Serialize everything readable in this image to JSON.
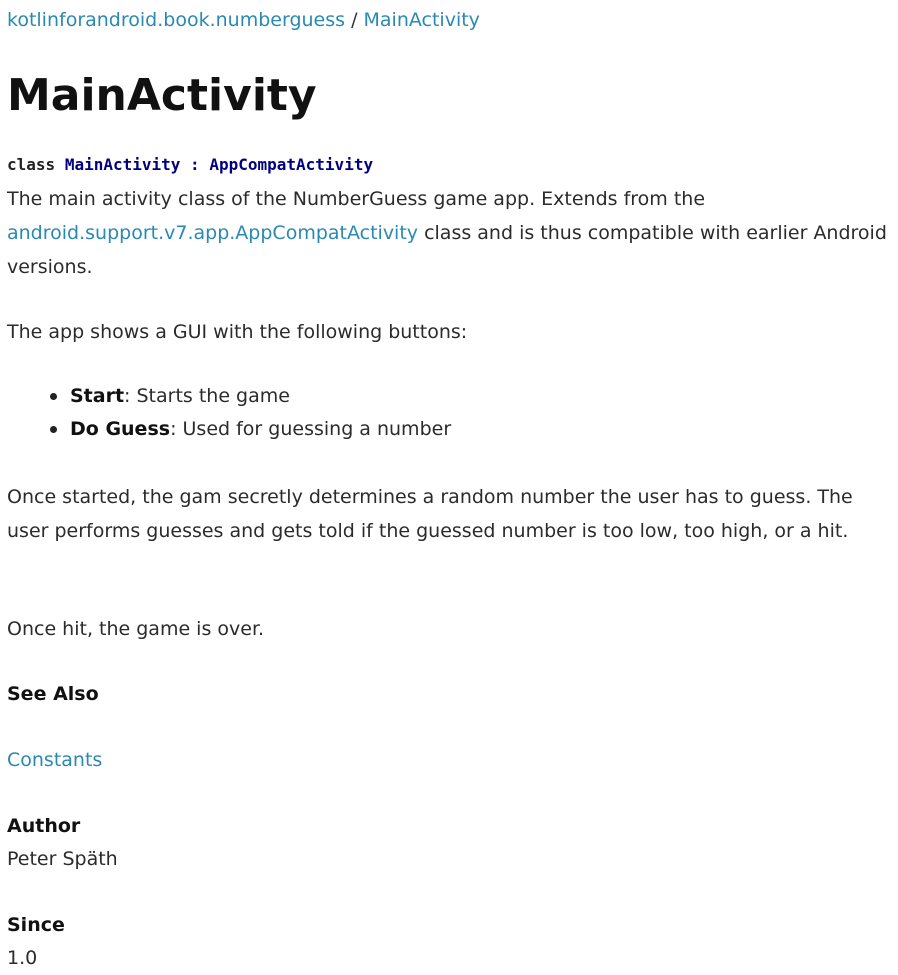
{
  "breadcrumb": {
    "package": "kotlinforandroid.book.numberguess",
    "separator": " / ",
    "current": "MainActivity"
  },
  "title": "MainActivity",
  "signature": {
    "keyword": "class",
    "name": "MainActivity",
    "colon": ":",
    "parent": "AppCompatActivity"
  },
  "description": {
    "before_link": "The main activity class of the NumberGuess game app. Extends from the ",
    "link": "android.support.v7.app.AppCompatActivity",
    "after_link": " class and is thus compatible with earlier Android versions."
  },
  "intro": "The app shows a GUI with the following buttons:",
  "buttons": [
    {
      "name": "Start",
      "desc": ": Starts the game"
    },
    {
      "name": "Do Guess",
      "desc": ": Used for guessing a number"
    }
  ],
  "para2": "Once started, the gam secretly determines a random number the user has to guess. The user performs guesses and gets told if the guessed number is too low, too high, or a hit.",
  "para3": "Once hit, the game is over.",
  "see_also": {
    "heading": "See Also",
    "link": "Constants"
  },
  "author": {
    "heading": "Author",
    "value": "Peter Späth"
  },
  "since": {
    "heading": "Since",
    "value": "1.0"
  },
  "colors": {
    "link": "#2a89b3",
    "code_identifier": "#000080",
    "text": "#2b2b2b"
  }
}
